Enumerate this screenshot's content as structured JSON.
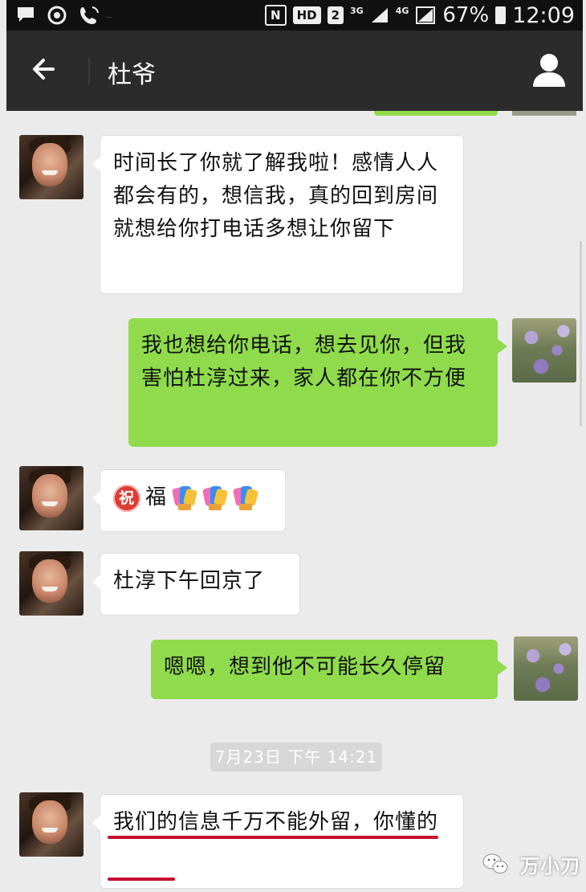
{
  "status_bar": {
    "left_icons": [
      "message-icon",
      "sync-icon",
      "phone-call-icon"
    ],
    "tiny_text": "…",
    "badges": [
      "N",
      "HD",
      "2"
    ],
    "network_1": "3G",
    "network_2": "4G",
    "battery": "67%",
    "time": "12:09"
  },
  "header": {
    "back_icon": "arrow-left-icon",
    "title": "杜爷",
    "profile_icon": "person-icon"
  },
  "messages": [
    {
      "side": "in",
      "text": "时间长了你就了解我啦！感情人人都会有的，想信我，真的回到房间就想给你打电话多想让你留下"
    },
    {
      "side": "out",
      "text": "我也想给你电话，想去见你，但我害怕杜淳过来，家人都在你不方便"
    },
    {
      "side": "in",
      "text": "福",
      "badge": "祝",
      "emoji_count": 3
    },
    {
      "side": "in",
      "text": "杜淳下午回京了"
    },
    {
      "side": "out",
      "text": "嗯嗯，想到他不可能长久停留"
    },
    {
      "side": "in",
      "text": "我们的信息千万不能外留，你懂的",
      "underlined": true
    }
  ],
  "timestamp": "7月23日 下午 14:21",
  "watermark": {
    "text": "万小刀",
    "icon": "wechat-official-icon"
  }
}
